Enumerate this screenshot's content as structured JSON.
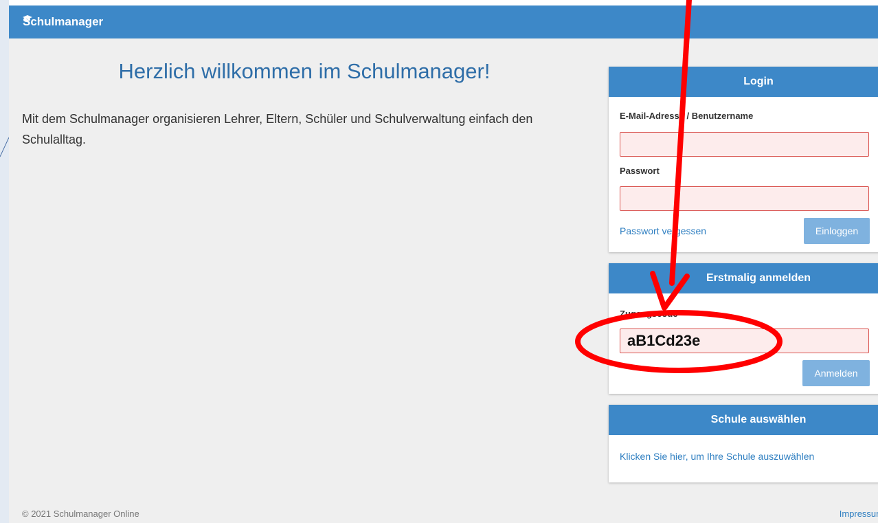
{
  "app": {
    "brand": "Schulmanager"
  },
  "welcome": {
    "title": "Herzlich willkommen im Schulmanager!",
    "text": "Mit dem Schulmanager organisieren Lehrer, Eltern, Schüler und Schulverwaltung einfach den Schulalltag."
  },
  "login": {
    "header": "Login",
    "email_label": "E-Mail-Adresse / Benutzername",
    "email_value": "",
    "password_label": "Passwort",
    "password_value": "",
    "forgot_link": "Passwort vergessen",
    "submit_label": "Einloggen"
  },
  "first_login": {
    "header": "Erstmalig anmelden",
    "code_label": "Zugangscode",
    "code_value": "aB1Cd23e",
    "submit_label": "Anmelden"
  },
  "school": {
    "header": "Schule auswählen",
    "link": "Klicken Sie hier, um Ihre Schule auszuwählen"
  },
  "footer": {
    "copyright": "© 2021 Schulmanager Online",
    "imprint": "Impressum"
  },
  "colors": {
    "primary": "#3d88c8",
    "title": "#2f6ea8",
    "input_error_bg": "#fdecec",
    "input_error_border": "#d9534f",
    "button": "#7fb2df",
    "annotation": "#ff0000"
  },
  "icons": {
    "brand": "graduation-cap-icon",
    "annotation_arrow": "arrow-down-icon",
    "annotation_ellipse": "highlight-ellipse"
  }
}
